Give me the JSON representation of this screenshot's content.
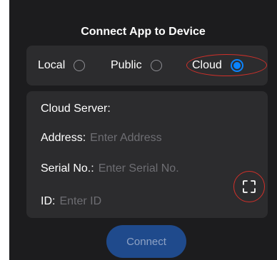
{
  "title": "Connect App to Device",
  "mode": {
    "options": [
      {
        "label": "Local",
        "selected": false
      },
      {
        "label": "Public",
        "selected": false
      },
      {
        "label": "Cloud",
        "selected": true
      }
    ]
  },
  "form": {
    "section_label": "Cloud Server:",
    "address": {
      "label": "Address:",
      "value": "",
      "placeholder": "Enter Address"
    },
    "serial": {
      "label": "Serial No.:",
      "value": "",
      "placeholder": "Enter Serial No."
    },
    "id": {
      "label": "ID:",
      "value": "",
      "placeholder": "Enter ID"
    },
    "scan_icon": "scan-icon"
  },
  "connect_label": "Connect",
  "colors": {
    "background": "#1c1c1e",
    "panel": "#2c2c2e",
    "accent": "#0a84ff",
    "annotation": "#d0302a",
    "button": "#1f4a8c"
  }
}
